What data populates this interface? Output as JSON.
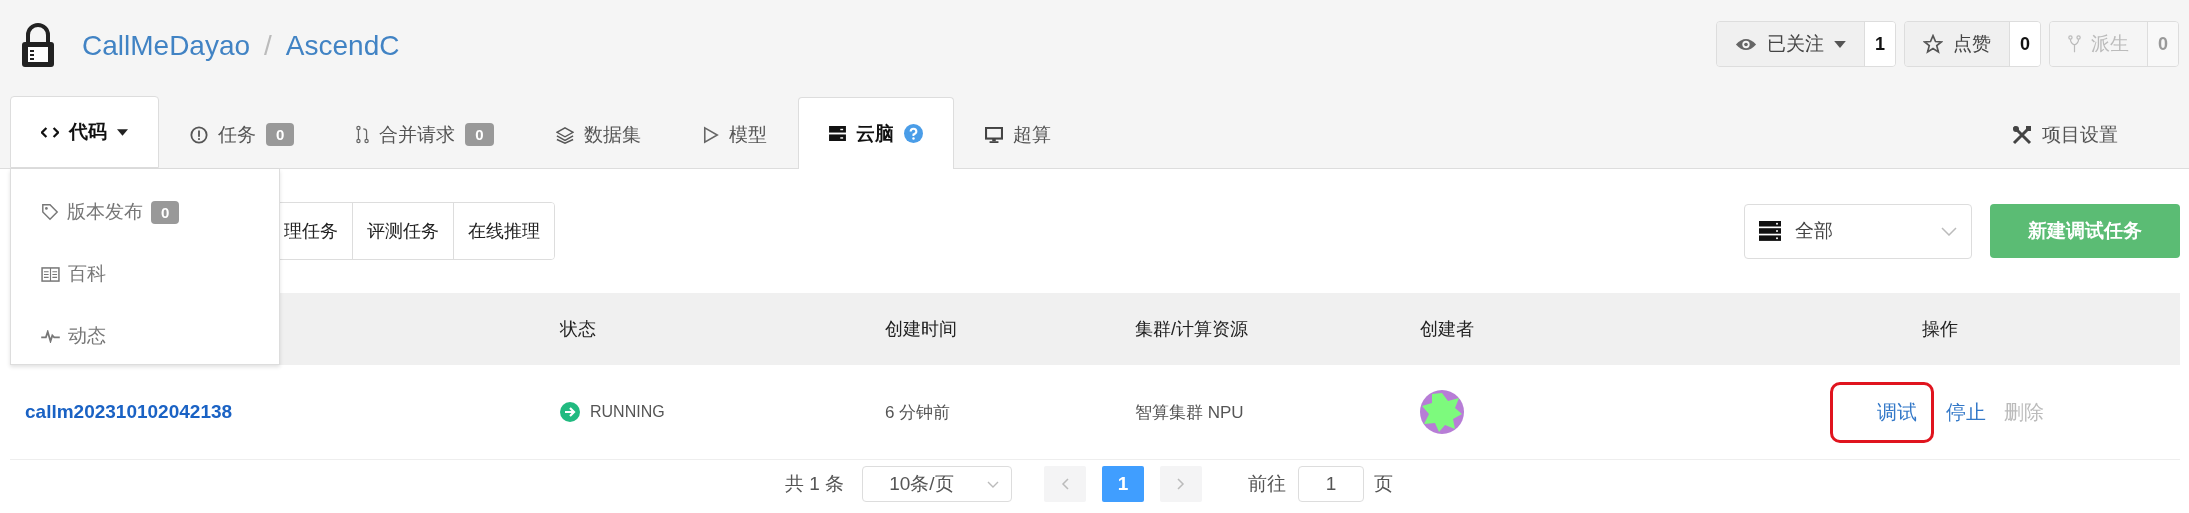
{
  "repo": {
    "owner": "CallMeDayao",
    "separator": "/",
    "name": "AscendC",
    "private": true
  },
  "repo_actions": [
    {
      "kind": "watch",
      "label": "已关注",
      "count": "1",
      "disabled": false
    },
    {
      "kind": "star",
      "label": "点赞",
      "count": "0",
      "disabled": false
    },
    {
      "kind": "fork",
      "label": "派生",
      "count": "0",
      "disabled": true
    }
  ],
  "tabs": [
    {
      "kind": "code",
      "label": "代码",
      "selected": false,
      "expanded": true
    },
    {
      "kind": "issues",
      "label": "任务",
      "badge": "0",
      "selected": false,
      "expanded": false
    },
    {
      "kind": "pulls",
      "label": "合并请求",
      "badge": "0",
      "selected": false,
      "expanded": false
    },
    {
      "kind": "datasets",
      "label": "数据集",
      "selected": false,
      "expanded": false
    },
    {
      "kind": "models",
      "label": "模型",
      "selected": false,
      "expanded": false
    },
    {
      "kind": "cloudbrain",
      "label": "云脑",
      "selected": true,
      "expanded": false
    },
    {
      "kind": "supercompute",
      "label": "超算",
      "selected": false,
      "expanded": false
    }
  ],
  "settings_tab": {
    "label": "项目设置"
  },
  "code_menu": [
    {
      "kind": "release",
      "label": "版本发布",
      "badge": "0"
    },
    {
      "kind": "wiki",
      "label": "百科"
    },
    {
      "kind": "activity",
      "label": "动态"
    }
  ],
  "sub_tabs": [
    {
      "label": "理任务",
      "selected": false
    },
    {
      "label": "评测任务",
      "selected": false
    },
    {
      "label": "在线推理",
      "selected": false
    }
  ],
  "filter": {
    "value": "全部"
  },
  "new_button": "新建调试任务",
  "table": {
    "columns": [
      "状态",
      "创建时间",
      "集群/计算资源",
      "创建者",
      "操作"
    ],
    "rows": [
      {
        "name": "callm202310102042138",
        "status": "RUNNING",
        "created": "6 分钟前",
        "cluster": "智算集群 NPU",
        "actions": [
          {
            "label": "调试",
            "disabled": false,
            "annotated": true
          },
          {
            "label": "停止",
            "disabled": false,
            "annotated": false
          },
          {
            "label": "删除",
            "disabled": true,
            "annotated": false
          }
        ]
      }
    ]
  },
  "pagination": {
    "total": "共 1 条",
    "page_size": "10条/页",
    "pages": [
      {
        "label": "1",
        "selected": true
      }
    ],
    "goto_label": "前往",
    "goto_value": "1",
    "goto_suffix": "页"
  }
}
